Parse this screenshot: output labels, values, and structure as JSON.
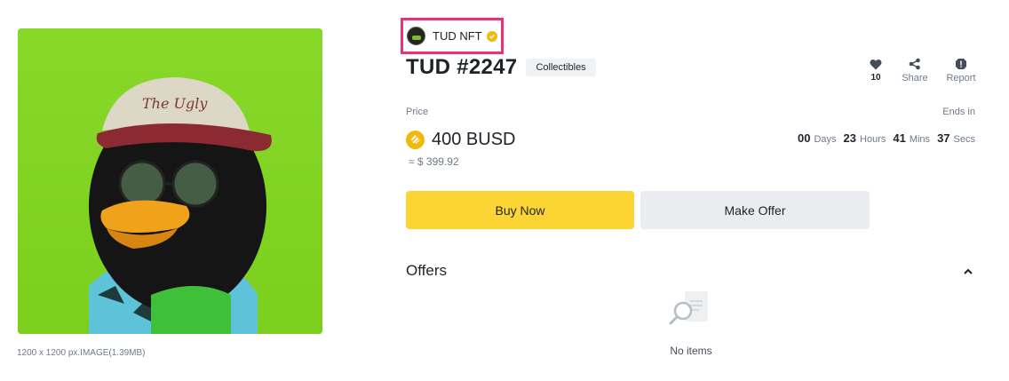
{
  "image": {
    "meta": "1200 x 1200 px.IMAGE(1.39MB)",
    "background_color": "#80d424"
  },
  "creator": {
    "name": "TUD NFT",
    "verified_icon": "verified-check-icon",
    "highlight_color": "#e8337a"
  },
  "nft": {
    "title": "TUD #2247",
    "category": "Collectibles"
  },
  "actions": {
    "like_count": "10",
    "share_label": "Share",
    "report_label": "Report"
  },
  "price": {
    "label": "Price",
    "amount": "400 BUSD",
    "usd": "≈ $ 399.92",
    "token_icon": "busd-icon"
  },
  "countdown": {
    "label": "Ends in",
    "days": "00",
    "days_unit": "Days",
    "hours": "23",
    "hours_unit": "Hours",
    "mins": "41",
    "mins_unit": "Mins",
    "secs": "37",
    "secs_unit": "Secs"
  },
  "buttons": {
    "buy_now": "Buy Now",
    "make_offer": "Make Offer"
  },
  "offers": {
    "title": "Offers",
    "empty_text": "No items"
  },
  "colors": {
    "primary_yellow": "#fcd535",
    "secondary_gray": "#eaecef",
    "text_muted": "#707a8a"
  }
}
